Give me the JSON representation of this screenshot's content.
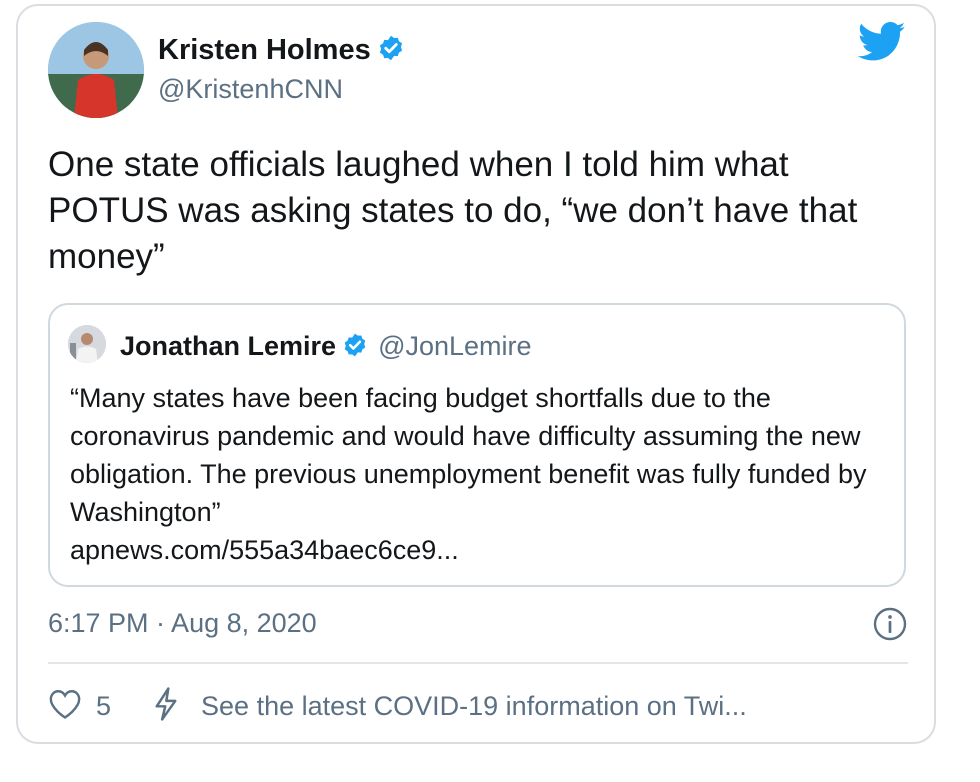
{
  "author": {
    "name": "Kristen Holmes",
    "handle": "@KristenhCNN",
    "avatar_icon": "profile-photo",
    "verified_icon": "verified-badge-icon"
  },
  "tweet": {
    "text": "One state officials laughed when I told him what POTUS was asking states to do, “we don’t have that money”"
  },
  "quoted_tweet": {
    "name": "Jonathan Lemire",
    "handle": "@JonLemire",
    "text": "“Many states have been facing budget shortfalls due to the coronavirus pandemic and would have difficulty assuming the new obligation. The previous unemployment benefit was fully funded by Washington”",
    "link": "apnews.com/555a34baec6ce9..."
  },
  "meta": {
    "timestamp": "6:17 PM · Aug 8, 2020"
  },
  "actions": {
    "like_count": "5",
    "covid_notice": "See the latest COVID-19 information on Twi..."
  },
  "colors": {
    "twitter_blue": "#1da1f2",
    "secondary_text": "#5b7083",
    "border": "#cfd9de"
  }
}
